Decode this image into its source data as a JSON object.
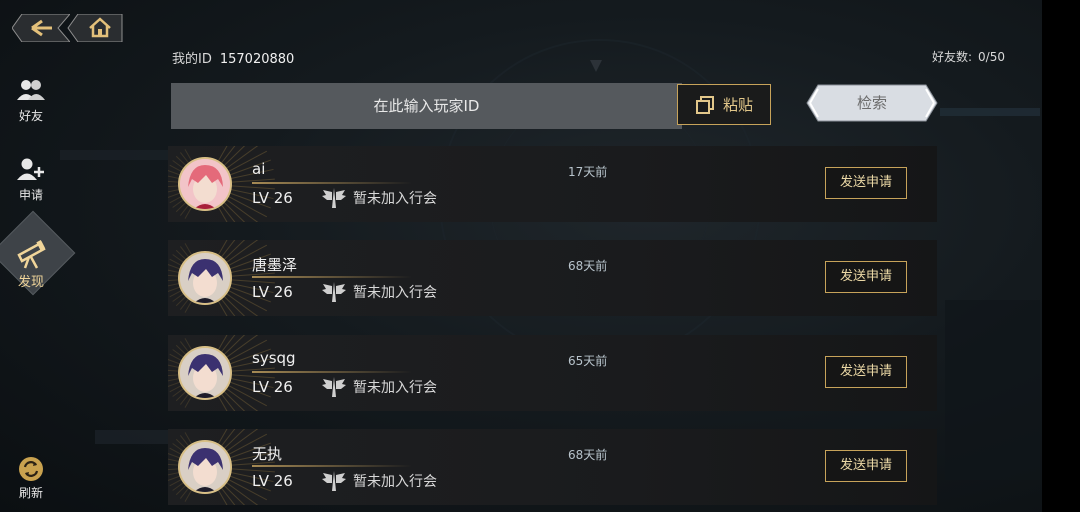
{
  "header": {
    "my_id_label": "我的ID",
    "my_id_value": "157020880",
    "friend_count_label": "好友数:",
    "friend_count_value": "0/50"
  },
  "sidebar": {
    "items": [
      {
        "label": "好友",
        "icon": "friends-icon"
      },
      {
        "label": "申请",
        "icon": "add-friend-icon"
      },
      {
        "label": "发现",
        "icon": "telescope-icon"
      },
      {
        "label": "刷新",
        "icon": "refresh-icon"
      }
    ]
  },
  "search": {
    "placeholder": "在此输入玩家ID",
    "paste_label": "粘贴",
    "search_label": "检索"
  },
  "players": [
    {
      "name": "ai",
      "level": "LV 26",
      "guild": "暂未加入行会",
      "time": "17天前",
      "action": "发送申请",
      "avatar": "pink-hair-avatar"
    },
    {
      "name": "唐墨泽",
      "level": "LV 26",
      "guild": "暂未加入行会",
      "time": "68天前",
      "action": "发送申请",
      "avatar": "dark-hair-avatar"
    },
    {
      "name": "sysqg",
      "level": "LV 26",
      "guild": "暂未加入行会",
      "time": "65天前",
      "action": "发送申请",
      "avatar": "dark-hair-avatar"
    },
    {
      "name": "无执",
      "level": "LV 26",
      "guild": "暂未加入行会",
      "time": "68天前",
      "action": "发送申请",
      "avatar": "dark-hair-avatar"
    }
  ],
  "colors": {
    "accent_gold": "#c7a35a",
    "background": "#141a1e",
    "row_bg": "#1e1f21"
  }
}
